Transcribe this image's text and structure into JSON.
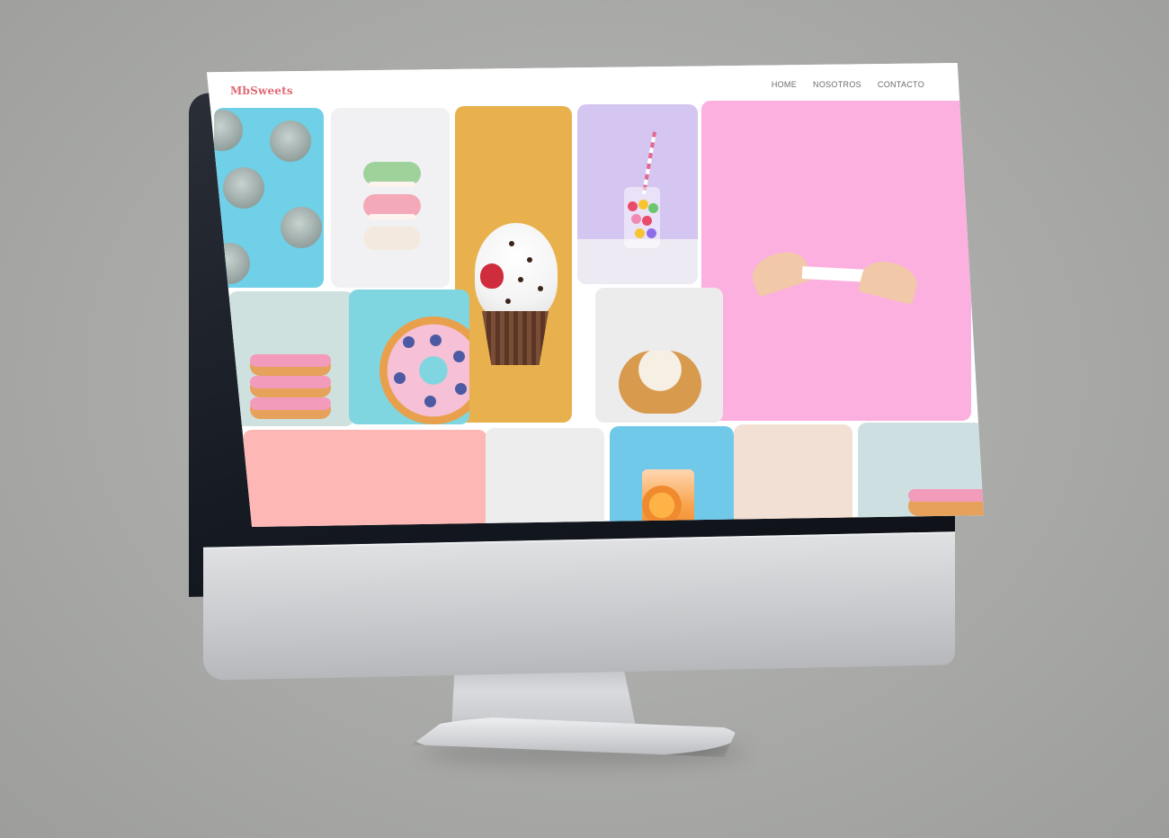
{
  "site": {
    "brand": "MbSweets",
    "nav": [
      {
        "label": "HOME"
      },
      {
        "label": "NOSOTROS"
      },
      {
        "label": "CONTACTO"
      }
    ]
  },
  "gallery": {
    "tiles": [
      {
        "subject": "meringues",
        "background": "#6fd0e8"
      },
      {
        "subject": "macarons",
        "background": "#f1f1f3"
      },
      {
        "subject": "cupcake",
        "background": "#e8b14d"
      },
      {
        "subject": "gumball-jar",
        "background": "#d5c5f1"
      },
      {
        "subject": "fortune-cookie",
        "background": "#fcb0df"
      },
      {
        "subject": "donut-stack",
        "background": "#cfe1df"
      },
      {
        "subject": "blueberry-donut",
        "background": "#7fd6e0"
      },
      {
        "subject": "caramel-donut",
        "background": "#ececed"
      },
      {
        "subject": "pink-blank",
        "background": "#fdb7b5"
      },
      {
        "subject": "grey-blank",
        "background": "#ededee"
      },
      {
        "subject": "orange-drink",
        "background": "#71c9ea"
      },
      {
        "subject": "beige-blank",
        "background": "#f2e0d4"
      },
      {
        "subject": "donut-partial",
        "background": "#cddfe0"
      }
    ]
  },
  "colors": {
    "brand": "#e06b75",
    "nav_text": "#6b6b6b",
    "bezel": "#141820",
    "chin": "#c9cbce"
  },
  "icons": {
    "device_logo": "apple-logo-icon"
  }
}
